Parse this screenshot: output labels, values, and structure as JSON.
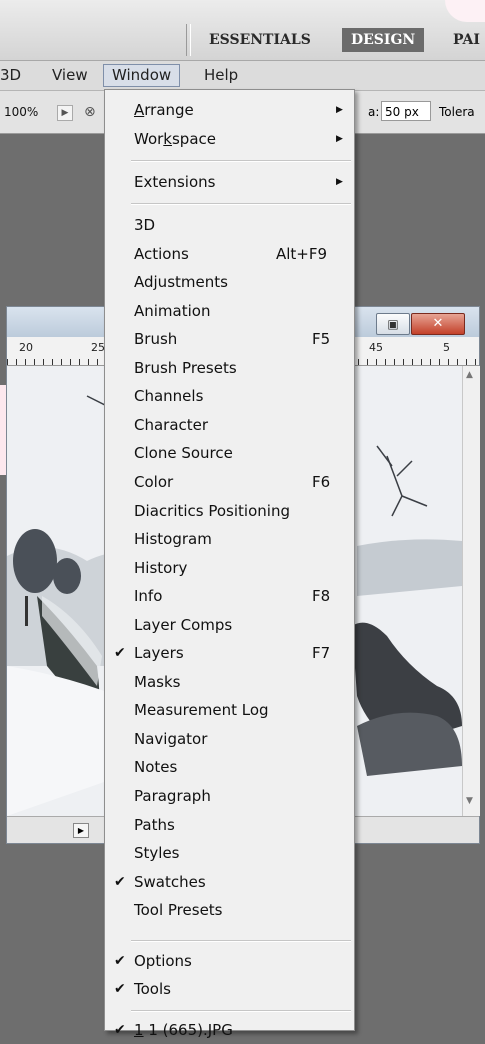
{
  "workspace_bar": {
    "buttons": [
      {
        "label": "ESSENTIALS",
        "active": false
      },
      {
        "label": "DESIGN",
        "active": true
      },
      {
        "label": "PAI",
        "active": false
      }
    ]
  },
  "menubar": {
    "items": [
      {
        "label": "3D"
      },
      {
        "label": "View"
      },
      {
        "label": "Window",
        "open": true
      },
      {
        "label": "Help"
      }
    ]
  },
  "options_bar": {
    "zoom": "100%",
    "field_label": "a:",
    "field_value": "50 px",
    "tolerance_label": "Tolera"
  },
  "document": {
    "ruler_ticks": [
      "20",
      "25",
      "45",
      "5"
    ]
  },
  "window_menu": {
    "arrange": {
      "label": "Arrange"
    },
    "workspace": {
      "label": "Workspace"
    },
    "extensions": {
      "label": "Extensions"
    },
    "panels": [
      {
        "label": "3D",
        "shortcut": ""
      },
      {
        "label": "Actions",
        "shortcut": "Alt+F9"
      },
      {
        "label": "Adjustments",
        "shortcut": ""
      },
      {
        "label": "Animation",
        "shortcut": ""
      },
      {
        "label": "Brush",
        "shortcut": "F5"
      },
      {
        "label": "Brush Presets",
        "shortcut": ""
      },
      {
        "label": "Channels",
        "shortcut": ""
      },
      {
        "label": "Character",
        "shortcut": ""
      },
      {
        "label": "Clone Source",
        "shortcut": ""
      },
      {
        "label": "Color",
        "shortcut": "F6"
      },
      {
        "label": "Diacritics Positioning",
        "shortcut": ""
      },
      {
        "label": "Histogram",
        "shortcut": ""
      },
      {
        "label": "History",
        "shortcut": ""
      },
      {
        "label": "Info",
        "shortcut": "F8"
      },
      {
        "label": "Layer Comps",
        "shortcut": ""
      },
      {
        "label": "Layers",
        "shortcut": "F7",
        "checked": true
      },
      {
        "label": "Masks",
        "shortcut": ""
      },
      {
        "label": "Measurement Log",
        "shortcut": ""
      },
      {
        "label": "Navigator",
        "shortcut": ""
      },
      {
        "label": "Notes",
        "shortcut": ""
      },
      {
        "label": "Paragraph",
        "shortcut": ""
      },
      {
        "label": "Paths",
        "shortcut": ""
      },
      {
        "label": "Styles",
        "shortcut": ""
      },
      {
        "label": "Swatches",
        "shortcut": "",
        "checked": true
      },
      {
        "label": "Tool Presets",
        "shortcut": ""
      }
    ],
    "options": {
      "label": "Options",
      "checked": true
    },
    "tools": {
      "label": "Tools",
      "checked": true
    },
    "document": {
      "label": "1 (665).JPG",
      "prefix": "1",
      "checked": true
    }
  }
}
